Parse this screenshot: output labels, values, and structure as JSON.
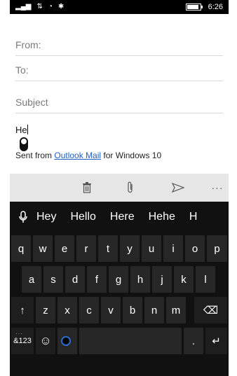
{
  "status_bar": {
    "signal_icons": [
      "signal-icon",
      "data-icon",
      "wifi-icon",
      "bluetooth-icon"
    ],
    "battery_level_percent": 80,
    "time": "6:26"
  },
  "compose": {
    "from_placeholder": "From:",
    "to_placeholder": "To:",
    "subject_placeholder": "Subject",
    "body_value": "He",
    "signature_prefix": "Sent from",
    "signature_link": "Outlook Mail",
    "signature_suffix": "for Windows 10"
  },
  "toolbar": {
    "icons": [
      "delete-icon",
      "attach-icon",
      "send-icon",
      "more-icon"
    ],
    "more_label": "···"
  },
  "keyboard": {
    "suggestions": [
      "Hey",
      "Hello",
      "Here",
      "Hehe",
      "H"
    ],
    "row1": [
      "q",
      "w",
      "e",
      "r",
      "t",
      "y",
      "u",
      "i",
      "o",
      "p"
    ],
    "row2": [
      "a",
      "s",
      "d",
      "f",
      "g",
      "h",
      "j",
      "k",
      "l"
    ],
    "row3_letters": [
      "z",
      "x",
      "c",
      "v",
      "b",
      "n",
      "m"
    ],
    "shift_label": "↑",
    "backspace_label": "⌫",
    "numbers_label": "&123",
    "emoji_label": "☺",
    "comma_label": ",",
    "period_label": ".",
    "enter_label": "↵",
    "more_dots": "···"
  }
}
